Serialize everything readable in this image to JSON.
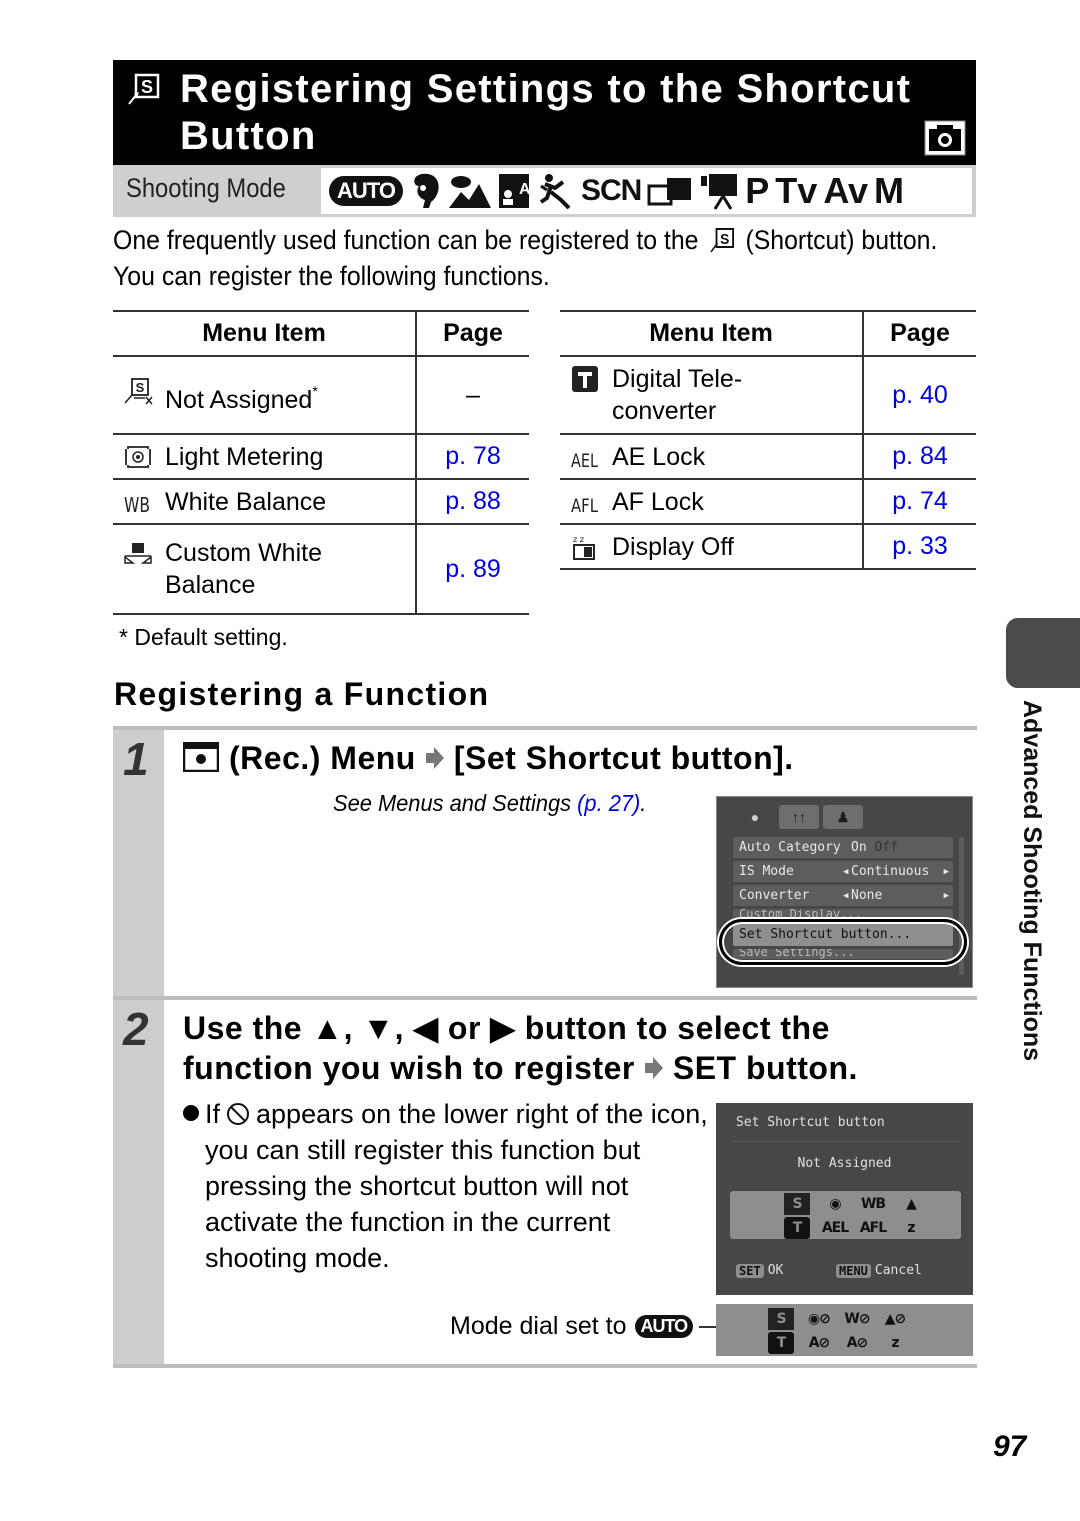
{
  "header": {
    "title_line1": "Registering Settings to the Shortcut",
    "title_line2": "Button",
    "title_icon": "shortcut-icon",
    "mode_icon": "camera-icon"
  },
  "shooting_mode": {
    "label": "Shooting Mode",
    "modes": [
      "AUTO",
      "portrait",
      "landscape",
      "night-scene",
      "sports",
      "SCN",
      "stitch-assist",
      "movie",
      "P",
      "Tv",
      "Av",
      "M"
    ]
  },
  "intro": {
    "line1_before_icon": "One frequently used function can be registered to the",
    "line1_after_icon": "(Shortcut) button.",
    "line2": "You can register the following functions."
  },
  "table_left": {
    "headers": [
      "Menu Item",
      "Page"
    ],
    "rows": [
      {
        "icon": "not-assigned-icon",
        "label": "Not Assigned",
        "marker": "*",
        "page": "–"
      },
      {
        "icon": "light-metering-icon",
        "label": "Light Metering",
        "page": "p. 78"
      },
      {
        "icon": "white-balance-icon",
        "label": "White Balance",
        "page": "p. 88"
      },
      {
        "icon": "custom-white-balance-icon",
        "label": "Custom White Balance",
        "page": "p. 89"
      }
    ]
  },
  "table_right": {
    "headers": [
      "Menu Item",
      "Page"
    ],
    "rows": [
      {
        "icon": "digital-tele-converter-icon",
        "label": "Digital Tele-converter",
        "page": "p. 40"
      },
      {
        "icon": "ae-lock-icon",
        "label": "AE Lock",
        "page": "p. 84"
      },
      {
        "icon": "af-lock-icon",
        "label": "AF Lock",
        "page": "p. 74"
      },
      {
        "icon": "display-off-icon",
        "label": "Display Off",
        "page": "p. 33"
      }
    ]
  },
  "footnote": "* Default setting.",
  "section_title": "Registering a Function",
  "step1": {
    "number": "1",
    "heading_mid": "(Rec.) Menu",
    "heading_end": "[Set Shortcut button].",
    "see_prefix": "See Menus and Settings ",
    "see_link": "(p. 27)",
    "see_suffix": ".",
    "lcd": {
      "tabs": [
        "camera",
        "setup",
        "my-menu"
      ],
      "rows": [
        {
          "label": "Auto Category",
          "value": "On",
          "value_dim": "Off"
        },
        {
          "label": "IS Mode",
          "value": "Continuous",
          "arrows": true
        },
        {
          "label": "Converter",
          "value": "None",
          "arrows": true
        },
        {
          "label": "Custom Display...",
          "partial": true
        },
        {
          "label": "Set Shortcut button...",
          "selected": true
        },
        {
          "label": "Save Settings...",
          "partial": true
        }
      ]
    }
  },
  "step2": {
    "number": "2",
    "heading_line1": "Use the ▲, ▼, ◀ or ▶ button to select the",
    "heading_line2_start": "function you wish to register",
    "heading_line2_end": "SET button.",
    "bullet_before_icon": "If",
    "bullet_after_icon": "appears on the lower right of the icon, you can still register this function but pressing the shortcut button will not activate the function in the current shooting mode.",
    "lcd": {
      "title": "Set Shortcut button",
      "current": "Not Assigned",
      "icons_row1": [
        "S",
        "◉",
        "WB",
        "▲"
      ],
      "icons_row2": [
        "T",
        "AEL",
        "AFL",
        "z"
      ],
      "ok_key": "SET",
      "ok_label": "OK",
      "cancel_key": "MENU",
      "cancel_label": "Cancel"
    },
    "mode_dial_label": "Mode dial set to",
    "mode_dial_value": "AUTO",
    "auto_icons_row1": [
      "S",
      "◉⊘",
      "W⊘",
      "▲⊘"
    ],
    "auto_icons_row2": [
      "T",
      "A⊘",
      "A⊘",
      "z"
    ]
  },
  "side_tab": "Advanced Shooting Functions",
  "page_number": "97",
  "colors": {
    "link": "#0000e6",
    "title_bg": "#000000",
    "step_bar": "#cdcdcd",
    "lcd_bg": "#474747"
  }
}
